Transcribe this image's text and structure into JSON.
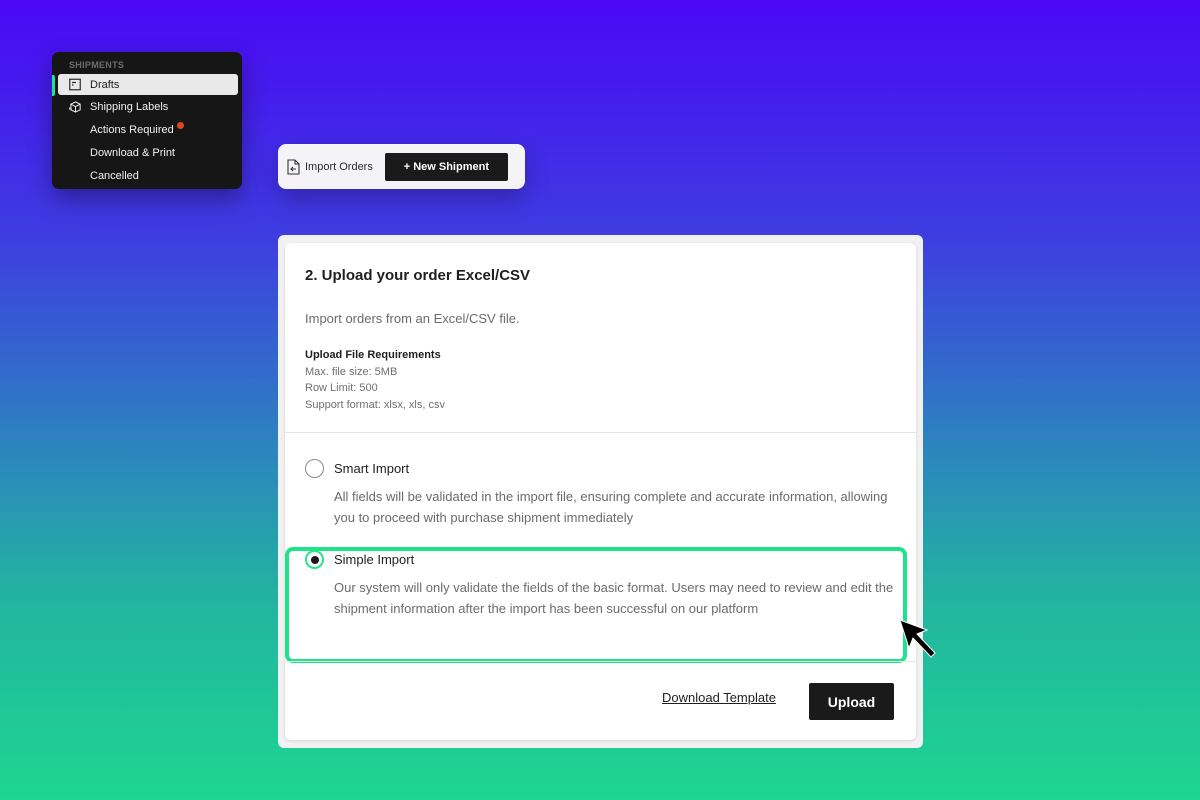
{
  "sidebar": {
    "section_label": "SHIPMENTS",
    "items": [
      {
        "label": "Drafts",
        "icon": "draft-icon",
        "active": true
      },
      {
        "label": "Shipping Labels",
        "icon": "package-icon",
        "active": false
      },
      {
        "label": "Actions Required",
        "icon": "",
        "active": false,
        "badge": "notification-dot"
      },
      {
        "label": "Download & Print",
        "icon": "",
        "active": false
      },
      {
        "label": "Cancelled",
        "icon": "",
        "active": false
      }
    ],
    "accent_color": "#1fe38c",
    "badge_color": "#e0461d"
  },
  "toolbar": {
    "import_label": "Import Orders",
    "new_shipment_label": "+ New Shipment"
  },
  "modal": {
    "title": "2. Upload your order Excel/CSV",
    "subtitle": "Import orders from an Excel/CSV file.",
    "requirements": {
      "title": "Upload File Requirements",
      "lines": [
        "Max. file size: 5MB",
        "Row Limit: 500",
        "Support format: xlsx, xls, csv"
      ]
    },
    "options": [
      {
        "label": "Smart Import",
        "description": "All fields will be validated in the import file, ensuring complete and accurate information, allowing you to proceed with purchase shipment immediately",
        "selected": false
      },
      {
        "label": "Simple Import",
        "description": "Our system will only validate the fields of the basic format. Users may need to review and edit the shipment information after the import has been successful on our platform",
        "selected": true
      }
    ],
    "download_template_label": "Download Template",
    "upload_label": "Upload",
    "highlight_color": "#1fe38c"
  }
}
